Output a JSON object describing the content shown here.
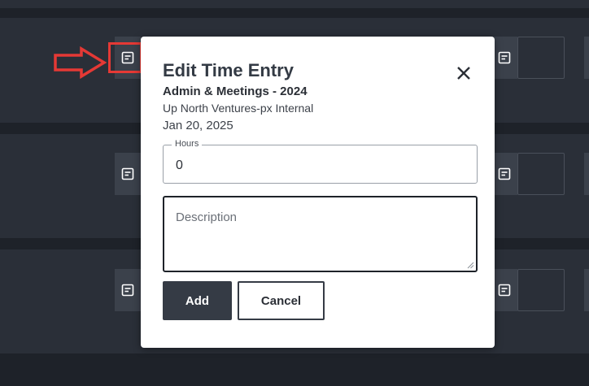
{
  "modal": {
    "title": "Edit Time Entry",
    "project": "Admin & Meetings - 2024",
    "client": "Up North Ventures-px Internal",
    "date": "Jan 20, 2025",
    "hours_label": "Hours",
    "hours_value": "0",
    "description_placeholder": "Description",
    "add_label": "Add",
    "cancel_label": "Cancel"
  },
  "rows": [
    {
      "icon": "note-icon"
    },
    {
      "icon": "note-icon"
    },
    {
      "icon": "note-icon"
    }
  ],
  "colors": {
    "background": "#1e2229",
    "row": "#2a2f38",
    "button": "#3b414b",
    "highlight": "#e53935",
    "modal": "#ffffff",
    "primary_button": "#353b45"
  }
}
